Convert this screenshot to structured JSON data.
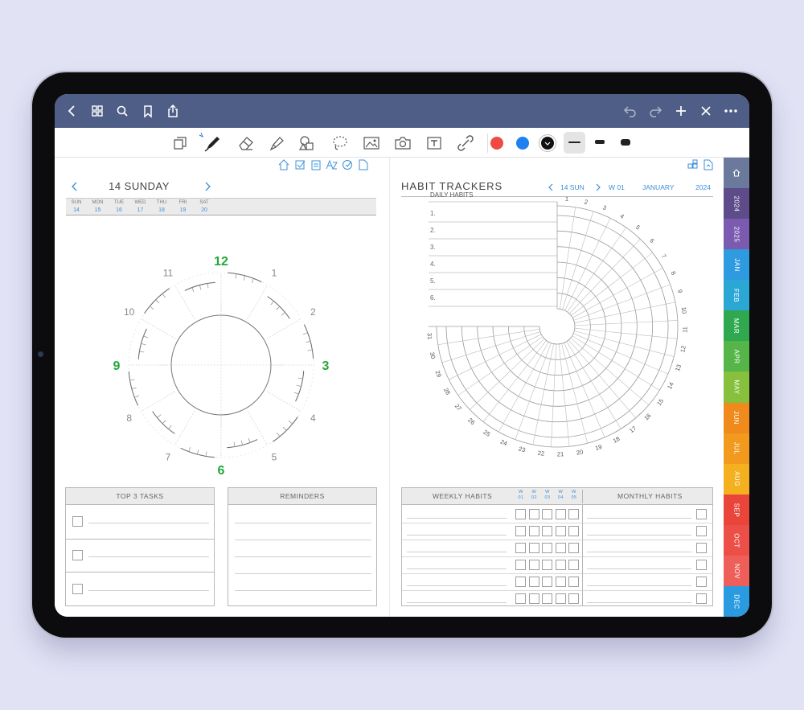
{
  "planner": {
    "day_title": "14 SUNDAY",
    "week_days": [
      {
        "name": "SUN",
        "date": "14"
      },
      {
        "name": "MON",
        "date": "15"
      },
      {
        "name": "TUE",
        "date": "16"
      },
      {
        "name": "WED",
        "date": "17"
      },
      {
        "name": "THU",
        "date": "18"
      },
      {
        "name": "FRI",
        "date": "19"
      },
      {
        "name": "SAT",
        "date": "20"
      }
    ],
    "clock_numbers": [
      "12",
      "1",
      "2",
      "3",
      "4",
      "5",
      "6",
      "7",
      "8",
      "9",
      "10",
      "11"
    ],
    "top_tasks_title": "TOP 3 TASKS",
    "reminders_title": "REMINDERS"
  },
  "habit": {
    "title": "HABIT TRACKERS",
    "nav_day": "14 SUN",
    "nav_week": "W 01",
    "nav_month": "JANUARY",
    "nav_year": "2024",
    "daily_habits_label": "DAILY HABITS",
    "daily_numbers": [
      "1.",
      "2.",
      "3.",
      "4.",
      "5.",
      "6."
    ],
    "day_numbers": [
      "1",
      "2",
      "3",
      "4",
      "5",
      "6",
      "7",
      "8",
      "9",
      "10",
      "11",
      "12",
      "13",
      "14",
      "15",
      "16",
      "17",
      "18",
      "19",
      "20",
      "21",
      "22",
      "23",
      "24",
      "25",
      "26",
      "27",
      "28",
      "29",
      "30",
      "31"
    ],
    "weekly_habits_title": "WEEKLY HABITS",
    "monthly_habits_title": "MONTHLY HABITS",
    "week_cols": [
      {
        "w": "W",
        "n": "01"
      },
      {
        "w": "W",
        "n": "02"
      },
      {
        "w": "W",
        "n": "03"
      },
      {
        "w": "W",
        "n": "04"
      },
      {
        "w": "W",
        "n": "05"
      }
    ]
  },
  "side_tabs": [
    {
      "label": "",
      "icon": "home-icon",
      "color": "#6b7a9c"
    },
    {
      "label": "2024",
      "color": "#5d4b8a"
    },
    {
      "label": "2025",
      "color": "#7a5bb0"
    },
    {
      "label": "JAN",
      "color": "#2e9be0"
    },
    {
      "label": "FEB",
      "color": "#2aa7d5"
    },
    {
      "label": "MAR",
      "color": "#2fa84f"
    },
    {
      "label": "APR",
      "color": "#55b548"
    },
    {
      "label": "MAY",
      "color": "#86c03c"
    },
    {
      "label": "JUN",
      "color": "#f08a1c"
    },
    {
      "label": "JUL",
      "color": "#f29a1e"
    },
    {
      "label": "AUG",
      "color": "#f4b01f"
    },
    {
      "label": "SEP",
      "color": "#e9453a"
    },
    {
      "label": "OCT",
      "color": "#ec4f47"
    },
    {
      "label": "NOV",
      "color": "#ee5f5a"
    },
    {
      "label": "DEC",
      "color": "#2a9be0"
    }
  ],
  "colors": {
    "pen_red": "#ef4b43",
    "pen_blue": "#1f80f0",
    "pen_black": "#111111",
    "green_accent": "#22a83a",
    "link_blue": "#3c8fd8"
  },
  "icons": {
    "topbar_left": [
      "back-icon",
      "grid-icon",
      "search-icon",
      "bookmark-icon",
      "share-icon"
    ],
    "topbar_right": [
      "undo-icon",
      "redo-icon",
      "add-icon",
      "close-icon",
      "more-icon"
    ],
    "toolbar": [
      "reader-icon",
      "pen-icon",
      "eraser-icon",
      "highlighter-icon",
      "shapes-icon",
      "lasso-icon",
      "image-icon",
      "camera-icon",
      "text-icon",
      "link-icon"
    ]
  }
}
